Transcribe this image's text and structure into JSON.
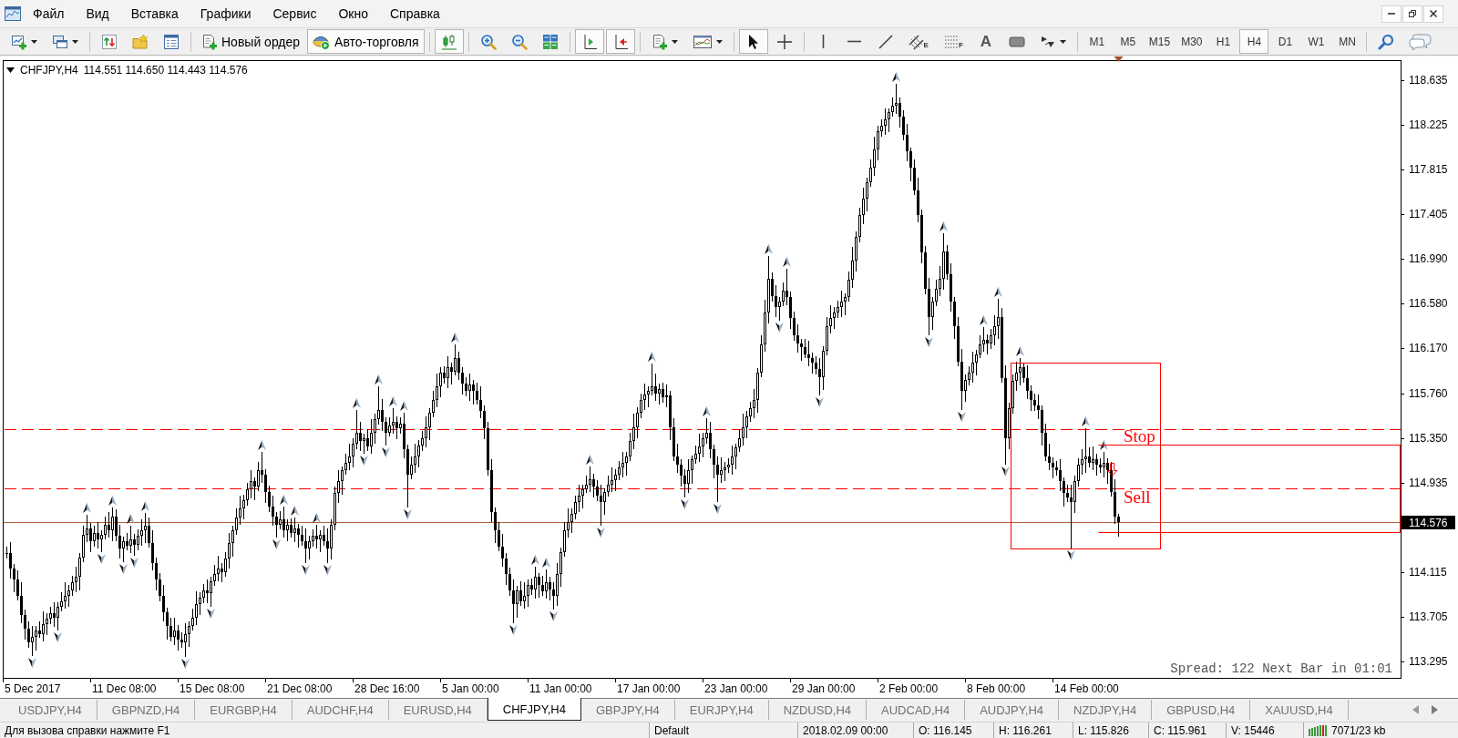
{
  "menu": {
    "items": [
      "Файл",
      "Вид",
      "Вставка",
      "Графики",
      "Сервис",
      "Окно",
      "Справка"
    ]
  },
  "toolbar": {
    "groups": [
      {
        "items": [
          {
            "kind": "new_chart",
            "dropdown": true
          },
          {
            "kind": "profiles",
            "dropdown": true
          }
        ]
      },
      {
        "items": [
          {
            "kind": "market_watch"
          },
          {
            "kind": "navigator"
          },
          {
            "kind": "terminal"
          }
        ]
      },
      {
        "items": [
          {
            "kind": "new_order",
            "label": "Новый ордер"
          },
          {
            "kind": "autotrading",
            "label": "Авто-торговля",
            "on": true
          }
        ]
      },
      {
        "items": [
          {
            "kind": "candles",
            "selected": true
          }
        ]
      },
      {
        "items": [
          {
            "kind": "zoom_in"
          },
          {
            "kind": "zoom_out"
          },
          {
            "kind": "tile"
          }
        ]
      },
      {
        "items": [
          {
            "kind": "chart_shift",
            "on": true
          },
          {
            "kind": "autoscroll",
            "on": true
          }
        ]
      },
      {
        "items": [
          {
            "kind": "indicators",
            "dropdown": true
          },
          {
            "kind": "templates",
            "dropdown": true
          }
        ]
      },
      {
        "items": [
          {
            "kind": "cursor",
            "selected": true
          },
          {
            "kind": "crosshair",
            "selected": false
          }
        ]
      },
      {
        "items": [
          {
            "kind": "vline"
          },
          {
            "kind": "hline"
          },
          {
            "kind": "trendline"
          },
          {
            "kind": "channel",
            "badge": "E"
          },
          {
            "kind": "fibo",
            "badge": "F"
          },
          {
            "kind": "text",
            "label": "A"
          },
          {
            "kind": "label"
          },
          {
            "kind": "arrows",
            "dropdown": true
          }
        ]
      },
      {
        "items": [
          {
            "kind": "timeframe",
            "label": "M1",
            "selected": false
          },
          {
            "kind": "timeframe",
            "label": "M5",
            "selected": false
          },
          {
            "kind": "timeframe",
            "label": "M15",
            "selected": false
          },
          {
            "kind": "timeframe",
            "label": "M30",
            "selected": false
          },
          {
            "kind": "timeframe",
            "label": "H1",
            "selected": false
          },
          {
            "kind": "timeframe",
            "label": "H4",
            "selected": true
          },
          {
            "kind": "timeframe",
            "label": "D1",
            "selected": false
          },
          {
            "kind": "timeframe",
            "label": "W1",
            "selected": false
          },
          {
            "kind": "timeframe",
            "label": "MN",
            "selected": false
          }
        ]
      },
      {
        "items": [
          {
            "kind": "search"
          },
          {
            "kind": "chat"
          }
        ]
      }
    ]
  },
  "chart": {
    "header": {
      "symbol": "CHFJPY,H4",
      "ohlc": "114.551 114.650 114.443 114.576"
    },
    "price_axis": [
      {
        "kind": "tick",
        "text": "118.635"
      },
      {
        "kind": "tick",
        "text": "118.225"
      },
      {
        "kind": "tick",
        "text": "117.815"
      },
      {
        "kind": "tick",
        "text": "117.405"
      },
      {
        "kind": "tick",
        "text": "116.990"
      },
      {
        "kind": "tick",
        "text": "116.580"
      },
      {
        "kind": "tick",
        "text": "116.170"
      },
      {
        "kind": "tick",
        "text": "115.760"
      },
      {
        "kind": "tick",
        "text": "115.350"
      },
      {
        "kind": "tick",
        "text": "114.935"
      },
      {
        "kind": "bid",
        "text": "114.576"
      },
      {
        "kind": "tick",
        "text": "114.115"
      },
      {
        "kind": "tick",
        "text": "113.705"
      },
      {
        "kind": "tick",
        "text": "113.295"
      }
    ],
    "time_axis": [
      "5 Dec 2017",
      "11 Dec 08:00",
      "15 Dec 08:00",
      "21 Dec 08:00",
      "28 Dec 16:00",
      "5 Jan 00:00",
      "11 Jan 00:00",
      "17 Jan 00:00",
      "23 Jan 00:00",
      "29 Jan 00:00",
      "2 Feb 00:00",
      "8 Feb 00:00",
      "14 Feb 00:00"
    ],
    "object_labels": [
      "Stop",
      "Sell"
    ],
    "info_label": "Spread: 122 Next Bar in 01:01"
  },
  "tabs": [
    {
      "label": "USDJPY,H4",
      "selected": false
    },
    {
      "label": "GBPNZD,H4",
      "selected": false
    },
    {
      "label": "EURGBP,H4",
      "selected": false
    },
    {
      "label": "AUDCHF,H4",
      "selected": false
    },
    {
      "label": "EURUSD,H4",
      "selected": false
    },
    {
      "label": "CHFJPY,H4",
      "selected": true
    },
    {
      "label": "GBPJPY,H4",
      "selected": false
    },
    {
      "label": "EURJPY,H4",
      "selected": false
    },
    {
      "label": "NZDUSD,H4",
      "selected": false
    },
    {
      "label": "AUDCAD,H4",
      "selected": false
    },
    {
      "label": "AUDJPY,H4",
      "selected": false
    },
    {
      "label": "NZDJPY,H4",
      "selected": false
    },
    {
      "label": "GBPUSD,H4",
      "selected": false
    },
    {
      "label": "XAUUSD,H4",
      "selected": false
    }
  ],
  "status_bar": {
    "help": "Для вызова справки нажмите F1",
    "profile": "Default",
    "datetime": "2018.02.09 00:00",
    "open": "O: 116.145",
    "high": "H: 116.261",
    "low": "L: 115.826",
    "close": "C: 115.961",
    "volume": "V: 15446",
    "traffic": "7071/23 kb"
  }
}
